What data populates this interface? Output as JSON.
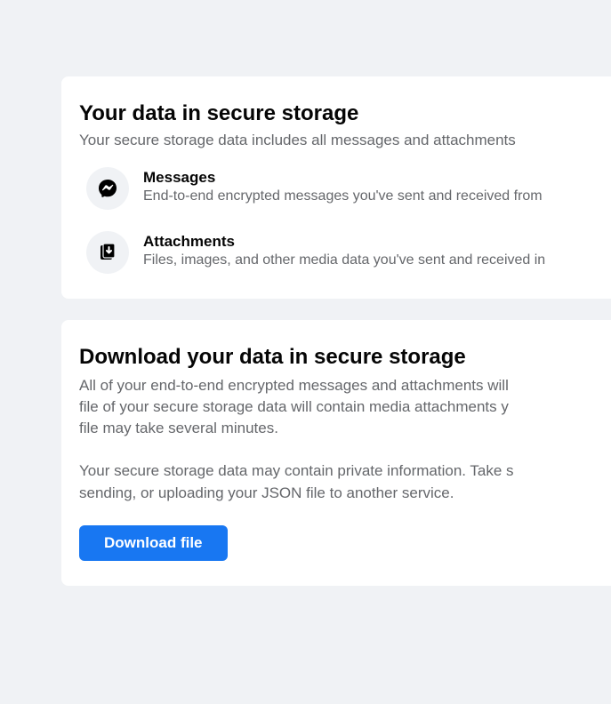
{
  "card1": {
    "title": "Your data in secure storage",
    "subtitle": "Your secure storage data includes all messages and attachments",
    "items": [
      {
        "title": "Messages",
        "desc": "End-to-end encrypted messages you've sent and received from"
      },
      {
        "title": "Attachments",
        "desc": "Files, images, and other media data you've sent and received in"
      }
    ]
  },
  "card2": {
    "title": "Download your data in secure storage",
    "p1_l1": "All of your end-to-end encrypted messages and attachments will",
    "p1_l2": "file of your secure storage data will contain media attachments y",
    "p1_l3": "file may take several minutes.",
    "p2_l1": "Your secure storage data may contain private information. Take s",
    "p2_l2": "sending, or uploading your JSON file to another service.",
    "button": "Download file"
  }
}
